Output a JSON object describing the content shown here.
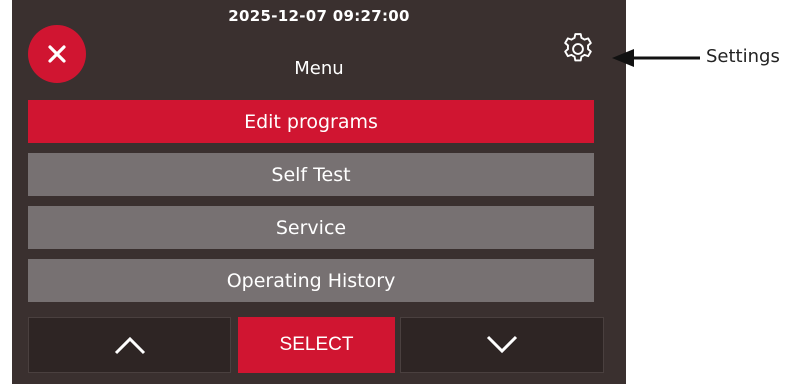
{
  "status": {
    "datetime": "2025-12-07 09:27:00"
  },
  "header": {
    "title": "Menu"
  },
  "menu": {
    "items": [
      {
        "label": "Edit programs",
        "selected": true
      },
      {
        "label": "Self Test",
        "selected": false
      },
      {
        "label": "Service",
        "selected": false
      },
      {
        "label": "Operating History",
        "selected": false
      }
    ]
  },
  "footer": {
    "select_label": "SELECT"
  },
  "annotation": {
    "label": "Settings"
  },
  "icons": {
    "close": "close-icon",
    "settings": "gear-icon",
    "up": "chevron-up-icon",
    "down": "chevron-down-icon",
    "arrow": "arrow-left-icon"
  },
  "colors": {
    "accent": "#d01531",
    "screen_bg": "#3a302f",
    "item_bg": "#777172",
    "nav_bg": "#2e2524"
  }
}
